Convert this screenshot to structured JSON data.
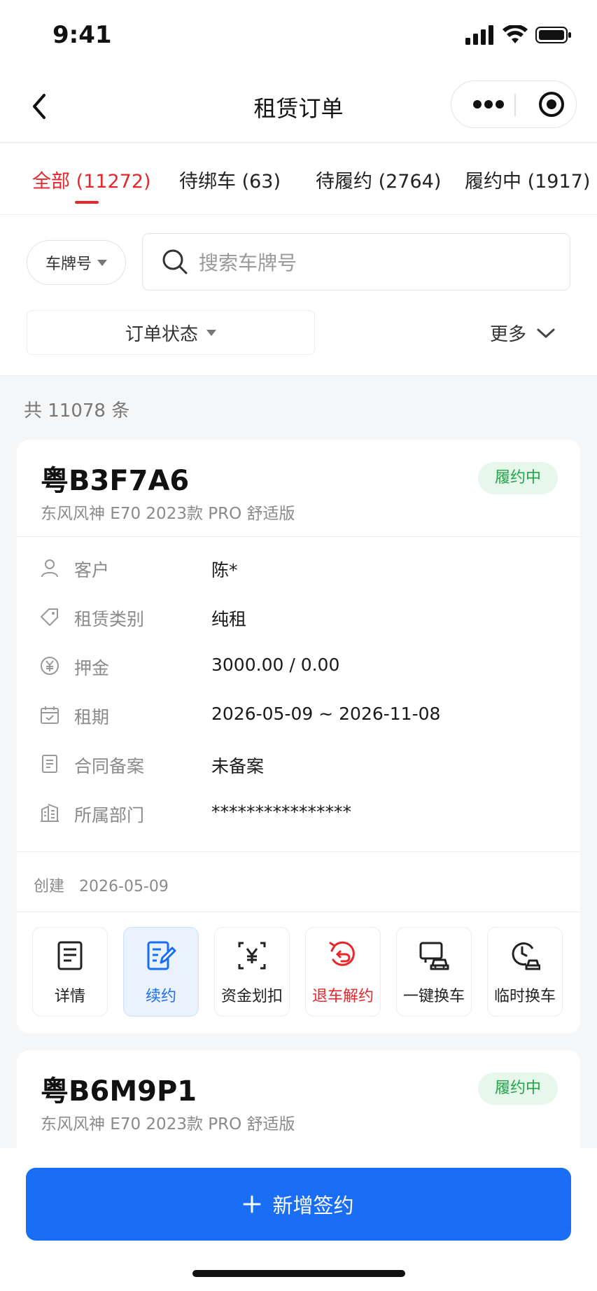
{
  "status_bar": {
    "time": "9:41"
  },
  "nav": {
    "title": "租赁订单"
  },
  "tabs": [
    {
      "label": "全部 (11272)",
      "active": true
    },
    {
      "label": "待绑车 (63)",
      "active": false
    },
    {
      "label": "待履约 (2764)",
      "active": false
    },
    {
      "label": "履约中 (1917)",
      "active": false
    }
  ],
  "filters": {
    "plate_select": "车牌号",
    "search_placeholder": "搜索车牌号",
    "status_select": "订单状态",
    "more": "更多"
  },
  "count_text": "共 11078 条",
  "orders": [
    {
      "plate": "粤B3F7A6",
      "model": "东风风神 E70 2023款 PRO 舒适版",
      "status": "履约中",
      "fields": [
        {
          "icon": "user-icon",
          "label": "客户",
          "value": "陈*"
        },
        {
          "icon": "tag-icon",
          "label": "租赁类别",
          "value": "纯租"
        },
        {
          "icon": "yuan-icon",
          "label": "押金",
          "value": "3000.00 / 0.00"
        },
        {
          "icon": "calendar-icon",
          "label": "租期",
          "value": "2026-05-09 ~ 2026-11-08"
        },
        {
          "icon": "document-icon",
          "label": "合同备案",
          "value": "未备案"
        },
        {
          "icon": "building-icon",
          "label": "所属部门",
          "value": "****************"
        }
      ],
      "created_label": "创建",
      "created_date": "2026-05-09",
      "actions": [
        {
          "icon": "detail-icon",
          "label": "详情"
        },
        {
          "icon": "edit-contract-icon",
          "label": "续约"
        },
        {
          "icon": "fund-deduct-icon",
          "label": "资金划扣"
        },
        {
          "icon": "return-icon",
          "label": "退车解约"
        },
        {
          "icon": "swap-car-icon",
          "label": "一键换车"
        },
        {
          "icon": "temp-swap-icon",
          "label": "临时换车"
        }
      ]
    },
    {
      "plate": "粤B6M9P1",
      "model": "东风风神 E70 2023款 PRO 舒适版",
      "status": "履约中"
    }
  ],
  "bottom": {
    "add_label": "新增签约"
  },
  "colors": {
    "accent_red": "#e8262b",
    "primary_blue": "#1a6ef5",
    "status_green": "#22a447"
  }
}
